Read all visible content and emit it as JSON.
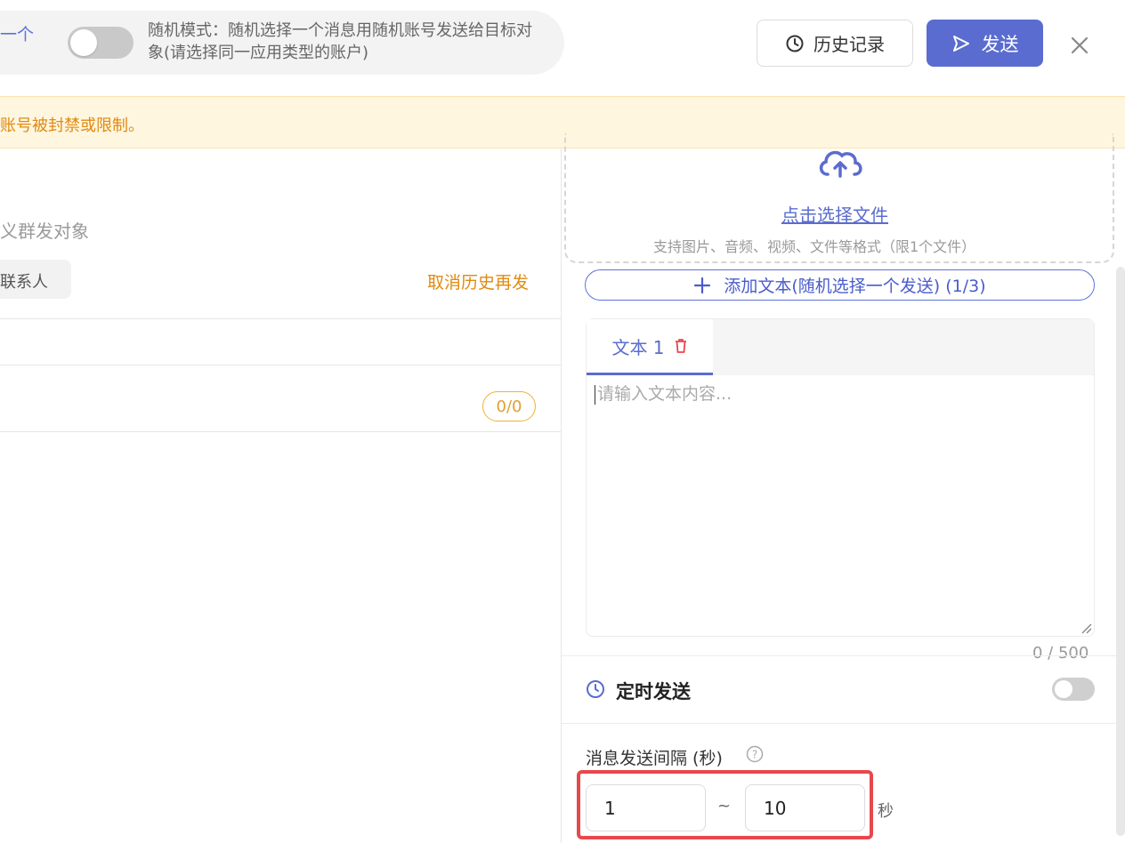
{
  "header": {
    "clipped_link": "一个",
    "random_mode_text": "随机模式：随机选择一个消息用随机账号发送给目标对象(请选择同一应用类型的账户)",
    "history_label": "历史记录",
    "send_label": "发送"
  },
  "warning": {
    "text": "账号被封禁或限制。"
  },
  "left": {
    "target_label": "义群发对象",
    "contact_chip": "联系人",
    "cancel_resend": "取消历史再发",
    "count_badge": "0/0"
  },
  "right": {
    "upload_link": "点击选择文件",
    "upload_hint": "支持图片、音频、视频、文件等格式（限1个文件）",
    "add_text_label": "添加文本(随机选择一个发送) (1/3)",
    "tab_label": "文本 1",
    "textarea_placeholder": "请输入文本内容...",
    "char_counter": "0 / 500",
    "scheduled_label": "定时发送",
    "interval_label": "消息发送间隔 (秒)",
    "interval_min": "1",
    "interval_sep": "~",
    "interval_max": "10",
    "interval_unit": "秒"
  },
  "colors": {
    "accent": "#5a6ccf",
    "warning": "#e08a10",
    "highlight": "#e8474c"
  }
}
